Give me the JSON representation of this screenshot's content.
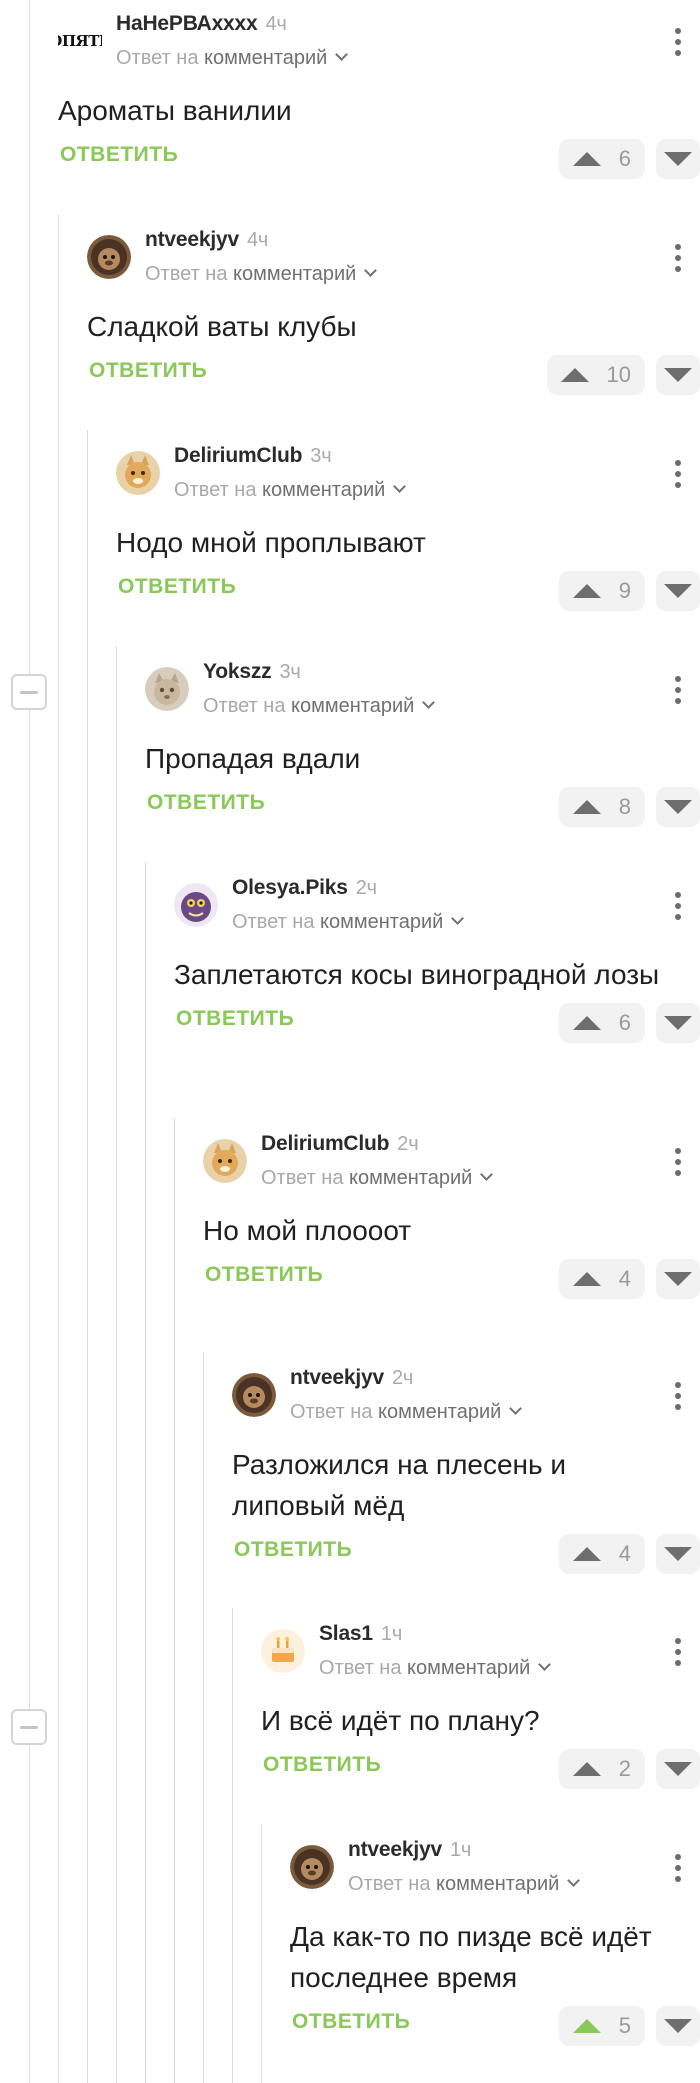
{
  "reply_prefix": "Ответ на",
  "reply_link": "комментарий",
  "reply_button_label": "ОТВЕТИТЬ",
  "colors": {
    "accent": "#8ac858",
    "line": "#dcdcdc"
  },
  "comments": [
    {
      "author": "НаНеРВАxxxx",
      "time": "4ч",
      "avatar": "text-logo-avatar",
      "avatar_text": "ОПЯТЬ",
      "text": "Ароматы ванилии",
      "rating": "6",
      "upvoted": false
    },
    {
      "author": "ntveekjyv",
      "time": "4ч",
      "avatar": "lion-avatar",
      "text": "Сладкой ваты клубы",
      "rating": "10",
      "upvoted": false
    },
    {
      "author": "DeliriumClub",
      "time": "3ч",
      "avatar": "cat-avatar",
      "text": "Нодо мной проплывают",
      "rating": "9",
      "upvoted": false
    },
    {
      "author": "Yokszz",
      "time": "3ч",
      "avatar": "kitten-avatar",
      "text": "Пропадая вдали",
      "rating": "8",
      "upvoted": false
    },
    {
      "author": "Olesya.Piks",
      "time": "2ч",
      "avatar": "purple-creature-avatar",
      "text": "Заплетаются косы виноградной лозы",
      "rating": "6",
      "upvoted": false
    },
    {
      "author": "DeliriumClub",
      "time": "2ч",
      "avatar": "cat-avatar",
      "text": "Но мой плоооот",
      "rating": "4",
      "upvoted": false
    },
    {
      "author": "ntveekjyv",
      "time": "2ч",
      "avatar": "lion-avatar",
      "text": "Разложился на плесень и липовый мёд",
      "rating": "4",
      "upvoted": false
    },
    {
      "author": "Slas1",
      "time": "1ч",
      "avatar": "cake-avatar",
      "text": "И всё идёт по плану?",
      "rating": "2",
      "upvoted": false
    },
    {
      "author": "ntveekjyv",
      "time": "1ч",
      "avatar": "lion-avatar",
      "text": "Да как-то по пизде всё идёт последнее время",
      "rating": "5",
      "upvoted": true
    }
  ]
}
